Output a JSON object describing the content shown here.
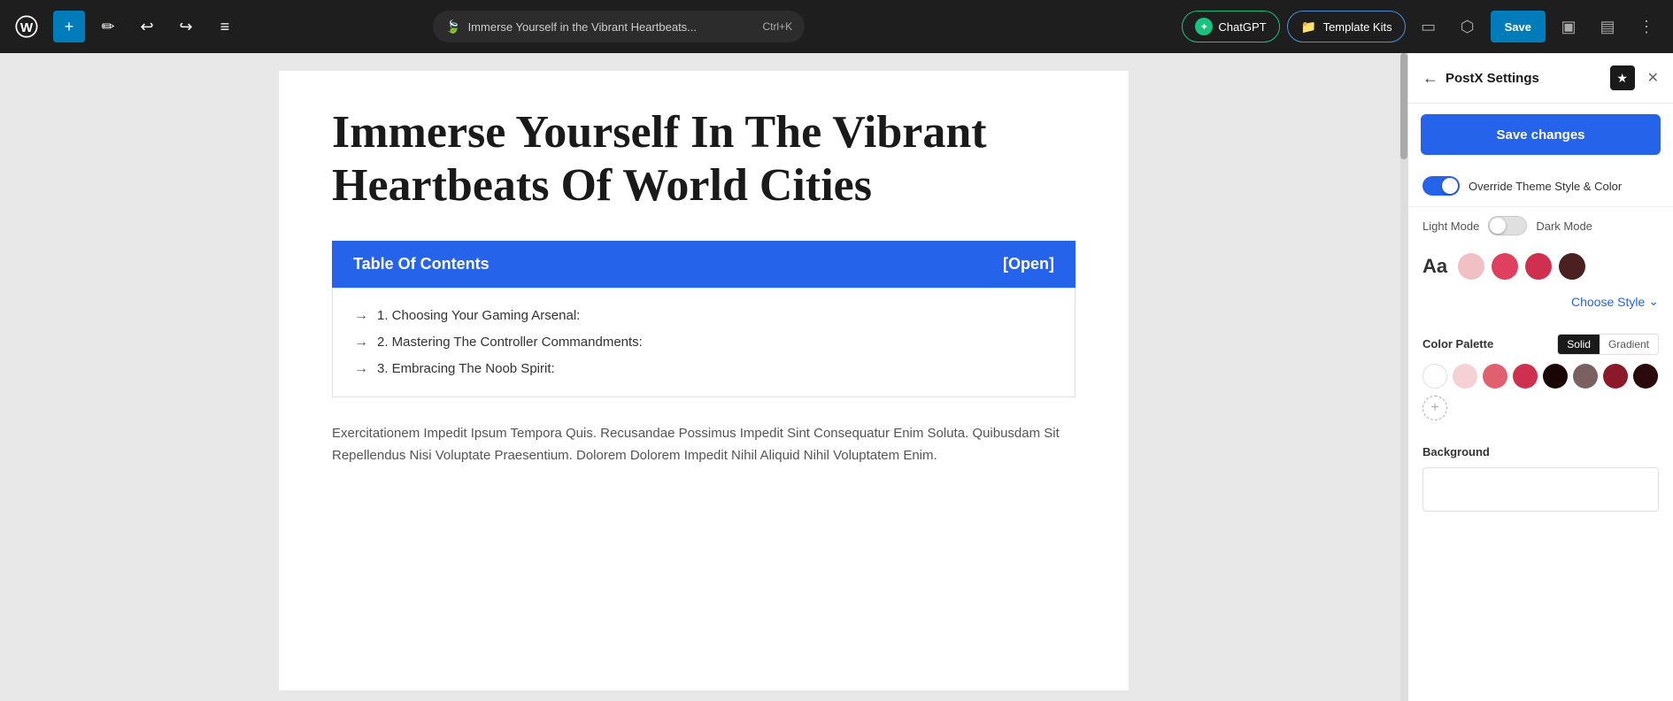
{
  "toolbar": {
    "url_text": "Immerse Yourself in the Vibrant Heartbeats...",
    "shortcut": "Ctrl+K",
    "chatgpt_label": "ChatGPT",
    "template_kits_label": "Template Kits",
    "save_label": "Save",
    "add_icon": "+",
    "pencil_icon": "✏",
    "undo_icon": "↩",
    "redo_icon": "↪",
    "list_icon": "≡",
    "desktop_icon": "▭",
    "external_icon": "⬡",
    "layout_icon": "▣",
    "split_icon": "▤",
    "more_icon": "⋮"
  },
  "canvas": {
    "page_title": "Immerse Yourself In The Vibrant Heartbeats Of World Cities",
    "toc_heading": "Table Of Contents",
    "toc_toggle": "[Open]",
    "toc_items": [
      "1. Choosing Your Gaming Arsenal:",
      "2. Mastering The Controller Commandments:",
      "3. Embracing The Noob Spirit:"
    ],
    "body_text": "Exercitationem Impedit Ipsum Tempora Quis. Recusandae Possimus Impedit Sint Consequatur Enim Soluta. Quibusdam Sit Repellendus Nisi Voluptate Praesentium. Dolorem Dolorem Impedit Nihil Aliquid Nihil Voluptatem Enim."
  },
  "panel": {
    "title": "PostX Settings",
    "back_icon": "←",
    "star_icon": "★",
    "close_icon": "✕",
    "save_changes_label": "Save changes",
    "override_label": "Override Theme Style & Color",
    "light_mode_label": "Light Mode",
    "dark_mode_label": "Dark Mode",
    "aa_label": "Aa",
    "choose_style_label": "Choose Style",
    "choose_style_chevron": "⌄",
    "color_palette_label": "Color Palette",
    "solid_label": "Solid",
    "gradient_label": "Gradient",
    "background_label": "Background",
    "swatches": [
      {
        "color": "#f0c0c5",
        "selected": false
      },
      {
        "color": "#e04060",
        "selected": false
      },
      {
        "color": "#d03050",
        "selected": false
      },
      {
        "color": "#4a2020",
        "selected": false
      }
    ],
    "palette_swatches": [
      {
        "color": "#ffffff",
        "white": true
      },
      {
        "color": "#f5d0d5",
        "white": false
      },
      {
        "color": "#e06070",
        "white": false
      },
      {
        "color": "#d03050",
        "white": false
      },
      {
        "color": "#1a0505",
        "white": false
      },
      {
        "color": "#7a6060",
        "white": false
      },
      {
        "color": "#8a1a2a",
        "white": false
      },
      {
        "color": "#2a0a0a",
        "white": false
      }
    ]
  }
}
